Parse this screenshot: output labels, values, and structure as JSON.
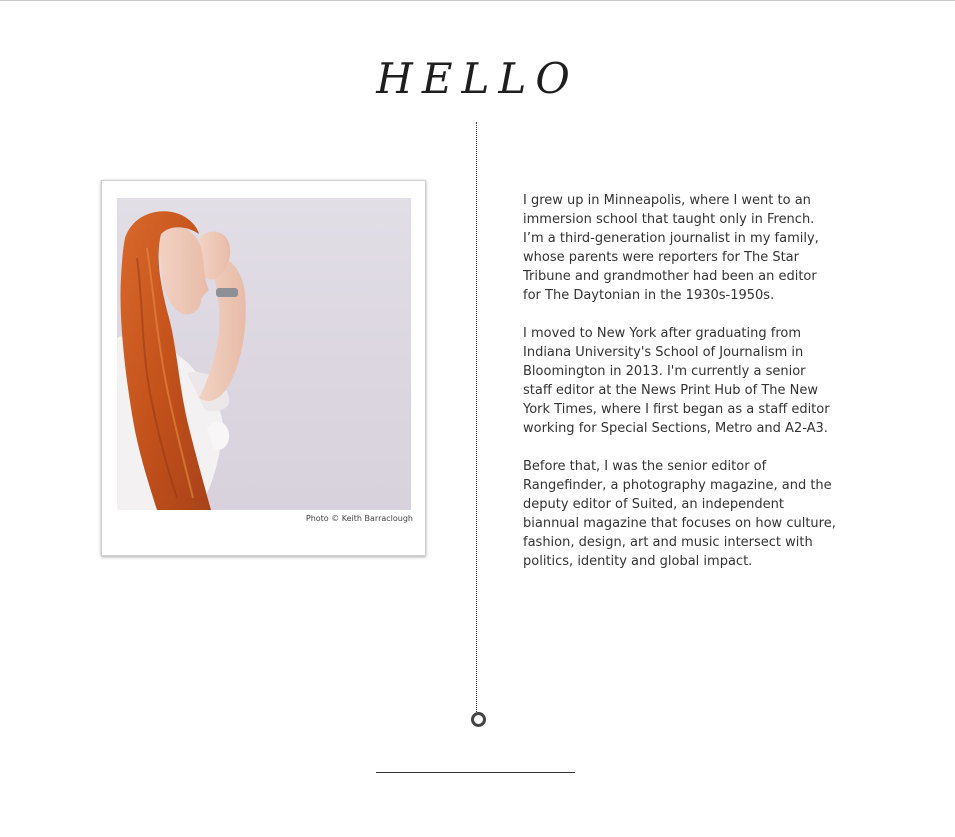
{
  "header": {
    "title": "HELLO"
  },
  "photo": {
    "credit": "Photo © Keith Barraclough",
    "alt": "Portrait of a woman with long red hair in profile"
  },
  "bio": {
    "paragraphs": [
      "I grew up in Minneapolis, where I went to an immersion school that taught only in French. I’m a third-generation journalist in my family, whose parents were reporters for The Star Tribune and grandmother had been an editor for The Daytonian in the 1930s-1950s.",
      "I moved to New York after graduating from Indiana University's School of Journalism in Bloomington in 2013. I'm currently a senior staff editor at the News Print Hub of The New York Times, where I first began as a staff editor working for Special Sections, Metro and A2-A3.",
      "Before that, I was the senior editor of Rangefinder, a photography magazine, and the deputy editor of Suited, an independent biannual magazine that focuses on how culture, fashion, design, art and music intersect with politics, identity and global impact."
    ]
  },
  "colors": {
    "text": "#333333",
    "hair": "#c9571f",
    "background": "#ffffff"
  }
}
